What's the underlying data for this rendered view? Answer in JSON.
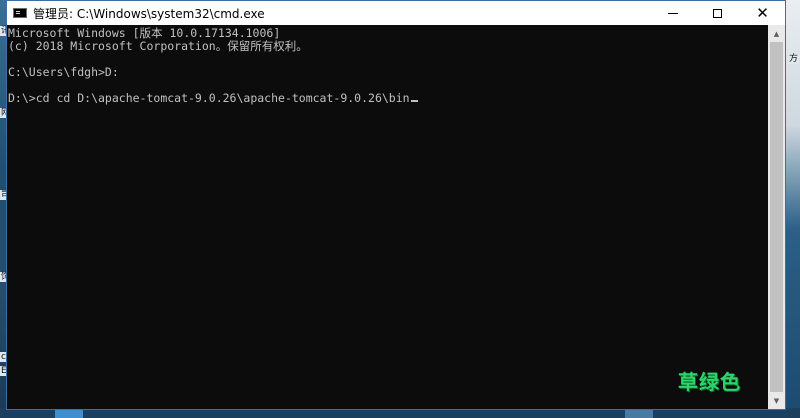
{
  "window": {
    "title": "管理员: C:\\Windows\\system32\\cmd.exe",
    "controls": {
      "minimize": "minimize",
      "maximize": "maximize",
      "close": "✕"
    }
  },
  "console": {
    "lines": [
      "Microsoft Windows [版本 10.0.17134.1006]",
      "(c) 2018 Microsoft Corporation。保留所有权利。",
      "",
      "C:\\Users\\fdgh>D:",
      "",
      "D:\\>cd cd D:\\apache-tomcat-9.0.26\\apache-tomcat-9.0.26\\bin"
    ]
  },
  "desktop": {
    "left_fragments": [
      "讯",
      "网",
      "司",
      "饰",
      "c",
      "Ec"
    ],
    "right_fragments": [
      "方"
    ]
  },
  "watermark": "草绿色",
  "colors": {
    "console_bg": "#0c0c0c",
    "console_text": "#c0c0c0",
    "titlebar_bg": "#ffffff",
    "watermark": "#2fd36c"
  }
}
